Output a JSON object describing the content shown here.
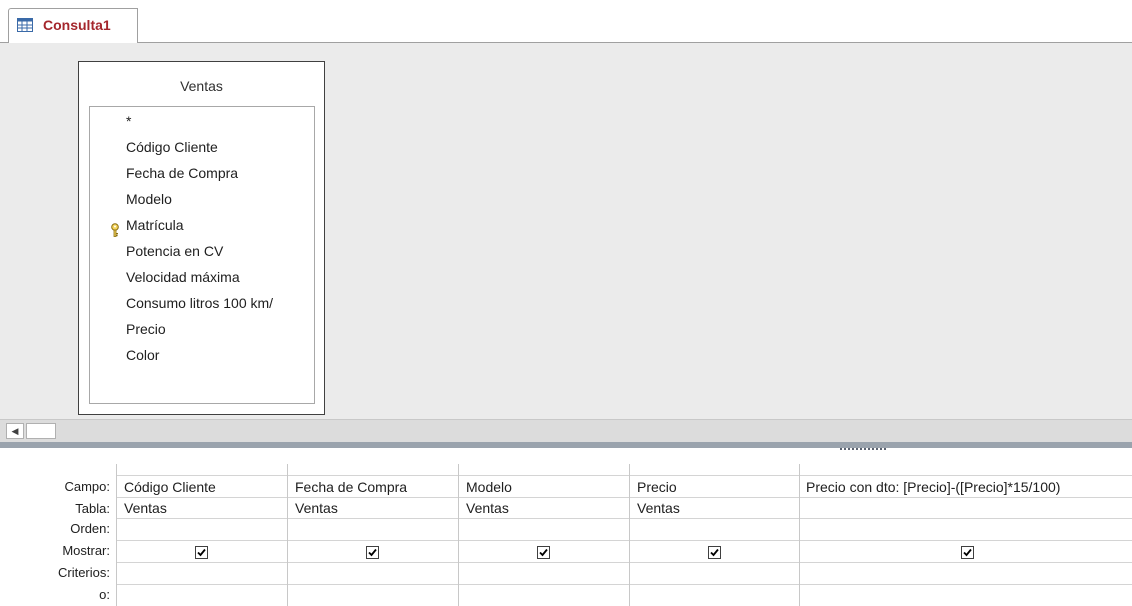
{
  "tab": {
    "label": "Consulta1"
  },
  "table": {
    "title": "Ventas",
    "fields": [
      "*",
      "Código Cliente",
      "Fecha de Compra",
      "Modelo",
      "Matrícula",
      "Potencia en CV",
      "Velocidad máxima",
      "Consumo litros 100 km/",
      "Precio",
      "Color"
    ],
    "primary_key": "Matrícula"
  },
  "grid": {
    "row_labels": [
      "Campo:",
      "Tabla:",
      "Orden:",
      "Mostrar:",
      "Criterios:",
      "o:"
    ],
    "columns": [
      {
        "campo": "Código Cliente",
        "tabla": "Ventas",
        "mostrar": true
      },
      {
        "campo": "Fecha de Compra",
        "tabla": "Ventas",
        "mostrar": true
      },
      {
        "campo": "Modelo",
        "tabla": "Ventas",
        "mostrar": true
      },
      {
        "campo": "Precio",
        "tabla": "Ventas",
        "mostrar": true
      },
      {
        "campo": "Precio con dto: [Precio]-([Precio]*15/100)",
        "tabla": "",
        "mostrar": true
      }
    ]
  },
  "colors": {
    "tab_text": "#a4262c",
    "design_bg": "#ebebeb",
    "splitter": "#9aa3ad"
  }
}
